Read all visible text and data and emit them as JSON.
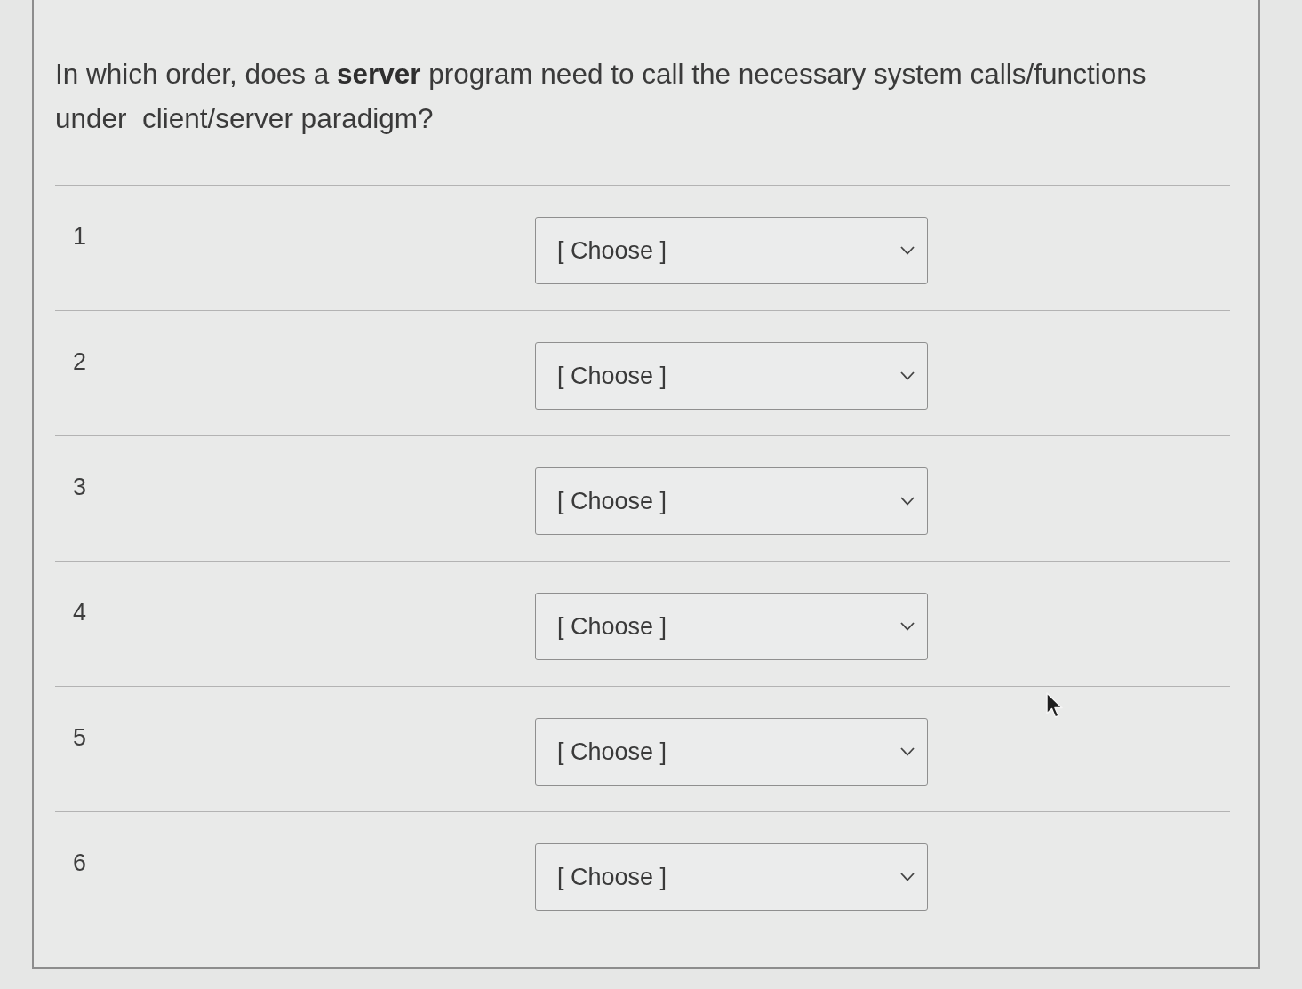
{
  "question": {
    "text": "In which order, does a **server** program need to call the necessary system calls/functions under  client/server paradigm?"
  },
  "rows": [
    {
      "label": "1",
      "value": "[ Choose ]"
    },
    {
      "label": "2",
      "value": "[ Choose ]"
    },
    {
      "label": "3",
      "value": "[ Choose ]"
    },
    {
      "label": "4",
      "value": "[ Choose ]"
    },
    {
      "label": "5",
      "value": "[ Choose ]"
    },
    {
      "label": "6",
      "value": "[ Choose ]"
    }
  ]
}
